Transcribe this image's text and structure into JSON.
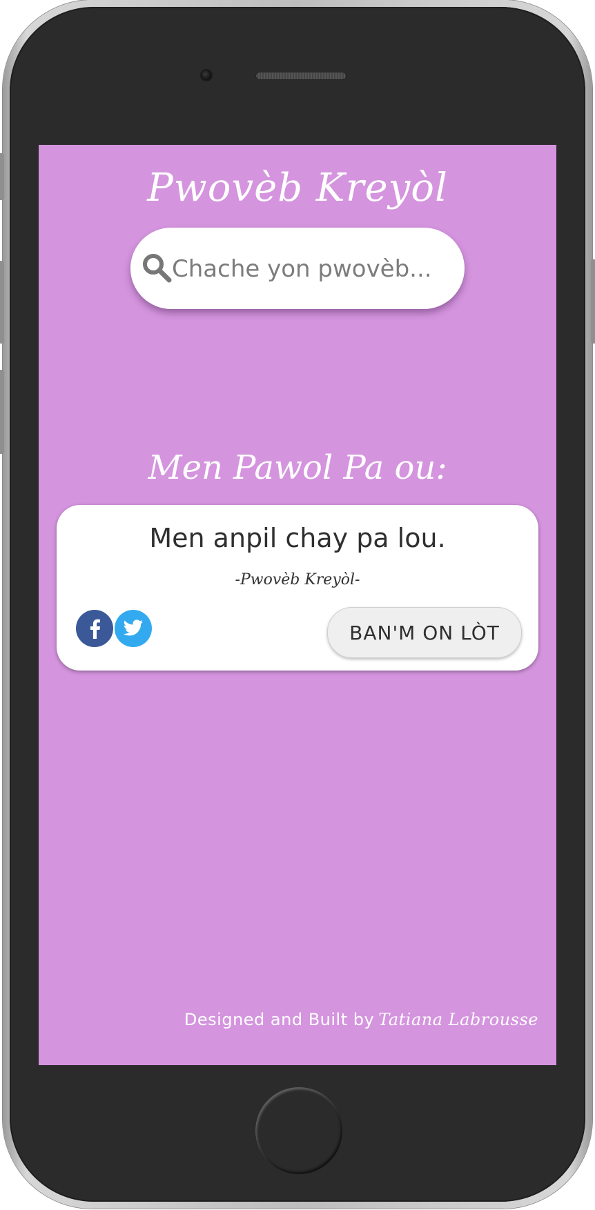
{
  "app": {
    "title": "Pwovèb Kreyòl"
  },
  "search": {
    "placeholder": "Chache yon pwovèb...",
    "icon": "search-icon"
  },
  "section": {
    "heading": "Men Pawol Pa ou:"
  },
  "quote_card": {
    "text": "Men anpil chay pa lou.",
    "source": "-Pwovèb Kreyòl-",
    "share_icons": [
      "facebook-icon",
      "twitter-icon"
    ],
    "random_button_label": "BAN'M ON LÒT"
  },
  "footer": {
    "prefix": "Designed and Built by",
    "author": "Tatiana Labrousse"
  },
  "colors": {
    "screen_background": "#d494de",
    "card_background": "#ffffff",
    "facebook": "#3b5998",
    "twitter": "#33aaf0"
  }
}
